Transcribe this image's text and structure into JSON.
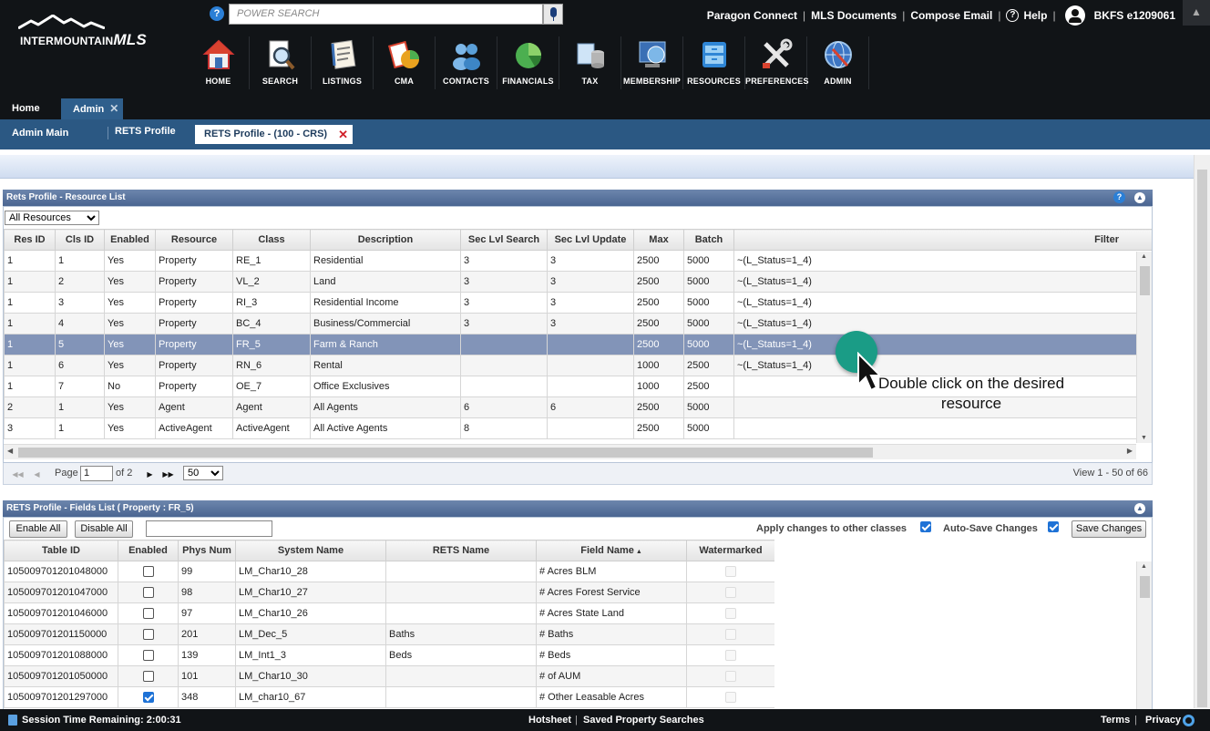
{
  "header": {
    "logo_text_a": "INTERMOUNTAIN",
    "logo_text_b": "MLS",
    "search_placeholder": "POWER SEARCH",
    "links": [
      "Paragon Connect",
      "MLS Documents",
      "Compose Email"
    ],
    "help_label": "Help",
    "user_label": "BKFS e1209061"
  },
  "nav": [
    {
      "label": "HOME",
      "icon": "home-icon"
    },
    {
      "label": "SEARCH",
      "icon": "search-icon"
    },
    {
      "label": "LISTINGS",
      "icon": "listings-icon"
    },
    {
      "label": "CMA",
      "icon": "cma-icon"
    },
    {
      "label": "CONTACTS",
      "icon": "contacts-icon"
    },
    {
      "label": "FINANCIALS",
      "icon": "financials-icon"
    },
    {
      "label": "TAX",
      "icon": "tax-icon"
    },
    {
      "label": "MEMBERSHIP",
      "icon": "membership-icon"
    },
    {
      "label": "RESOURCES",
      "icon": "resources-icon"
    },
    {
      "label": "PREFERENCES",
      "icon": "preferences-icon"
    },
    {
      "label": "ADMIN",
      "icon": "admin-icon"
    }
  ],
  "tabs": {
    "home": "Home",
    "admin": "Admin",
    "sub": [
      "Admin Main",
      "RETS Profile",
      "RETS Profile - (100 - CRS)"
    ]
  },
  "resource_panel": {
    "title": "Rets Profile - Resource List",
    "filter_select": "All Resources",
    "columns": [
      "Res ID",
      "Cls ID",
      "Enabled",
      "Resource",
      "Class",
      "Description",
      "Sec Lvl Search",
      "Sec Lvl Update",
      "Max",
      "Batch",
      "Filter"
    ],
    "rows": [
      [
        "1",
        "1",
        "Yes",
        "Property",
        "RE_1",
        "Residential",
        "3",
        "3",
        "2500",
        "5000",
        "~(L_Status=1_4)"
      ],
      [
        "1",
        "2",
        "Yes",
        "Property",
        "VL_2",
        "Land",
        "3",
        "3",
        "2500",
        "5000",
        "~(L_Status=1_4)"
      ],
      [
        "1",
        "3",
        "Yes",
        "Property",
        "RI_3",
        "Residential Income",
        "3",
        "3",
        "2500",
        "5000",
        "~(L_Status=1_4)"
      ],
      [
        "1",
        "4",
        "Yes",
        "Property",
        "BC_4",
        "Business/Commercial",
        "3",
        "3",
        "2500",
        "5000",
        "~(L_Status=1_4)"
      ],
      [
        "1",
        "5",
        "Yes",
        "Property",
        "FR_5",
        "Farm & Ranch",
        "",
        "",
        "2500",
        "5000",
        "~(L_Status=1_4)"
      ],
      [
        "1",
        "6",
        "Yes",
        "Property",
        "RN_6",
        "Rental",
        "",
        "",
        "1000",
        "2500",
        "~(L_Status=1_4)"
      ],
      [
        "1",
        "7",
        "No",
        "Property",
        "OE_7",
        "Office Exclusives",
        "",
        "",
        "1000",
        "2500",
        ""
      ],
      [
        "2",
        "1",
        "Yes",
        "Agent",
        "Agent",
        "All Agents",
        "6",
        "6",
        "2500",
        "5000",
        ""
      ],
      [
        "3",
        "1",
        "Yes",
        "ActiveAgent",
        "ActiveAgent",
        "All Active Agents",
        "8",
        "",
        "2500",
        "5000",
        ""
      ]
    ],
    "selected_row": 4,
    "pager": {
      "page_label": "Page",
      "page": "1",
      "of_label": "of 2",
      "page_size": "50",
      "view_text": "View 1 - 50 of 66"
    }
  },
  "fields_panel": {
    "title": "RETS Profile - Fields List ( Property : FR_5)",
    "enable_all": "Enable All",
    "disable_all": "Disable All",
    "apply_label": "Apply changes to other classes",
    "autosave_label": "Auto-Save Changes",
    "save_button": "Save Changes",
    "columns": [
      "Table ID",
      "Enabled",
      "Phys Num",
      "System Name",
      "RETS Name",
      "Field Name",
      "Watermarked"
    ],
    "rows": [
      {
        "table_id": "105009701201048000",
        "enabled": false,
        "phys": "99",
        "system": "LM_Char10_28",
        "rets": "",
        "field": "# Acres BLM"
      },
      {
        "table_id": "105009701201047000",
        "enabled": false,
        "phys": "98",
        "system": "LM_Char10_27",
        "rets": "",
        "field": "# Acres Forest Service"
      },
      {
        "table_id": "105009701201046000",
        "enabled": false,
        "phys": "97",
        "system": "LM_Char10_26",
        "rets": "",
        "field": "# Acres State Land"
      },
      {
        "table_id": "105009701201150000",
        "enabled": false,
        "phys": "201",
        "system": "LM_Dec_5",
        "rets": "Baths",
        "field": "# Baths"
      },
      {
        "table_id": "105009701201088000",
        "enabled": false,
        "phys": "139",
        "system": "LM_Int1_3",
        "rets": "Beds",
        "field": "# Beds"
      },
      {
        "table_id": "105009701201050000",
        "enabled": false,
        "phys": "101",
        "system": "LM_Char10_30",
        "rets": "",
        "field": "# of AUM"
      },
      {
        "table_id": "105009701201297000",
        "enabled": true,
        "phys": "348",
        "system": "LM_char10_67",
        "rets": "",
        "field": "# Other Leasable Acres"
      }
    ]
  },
  "callout": "Double click on the desired resource",
  "footer": {
    "session": "Session Time Remaining: 2:00:31",
    "hotsheet": "Hotsheet",
    "saved": "Saved Property Searches",
    "terms": "Terms",
    "privacy": "Privacy"
  }
}
